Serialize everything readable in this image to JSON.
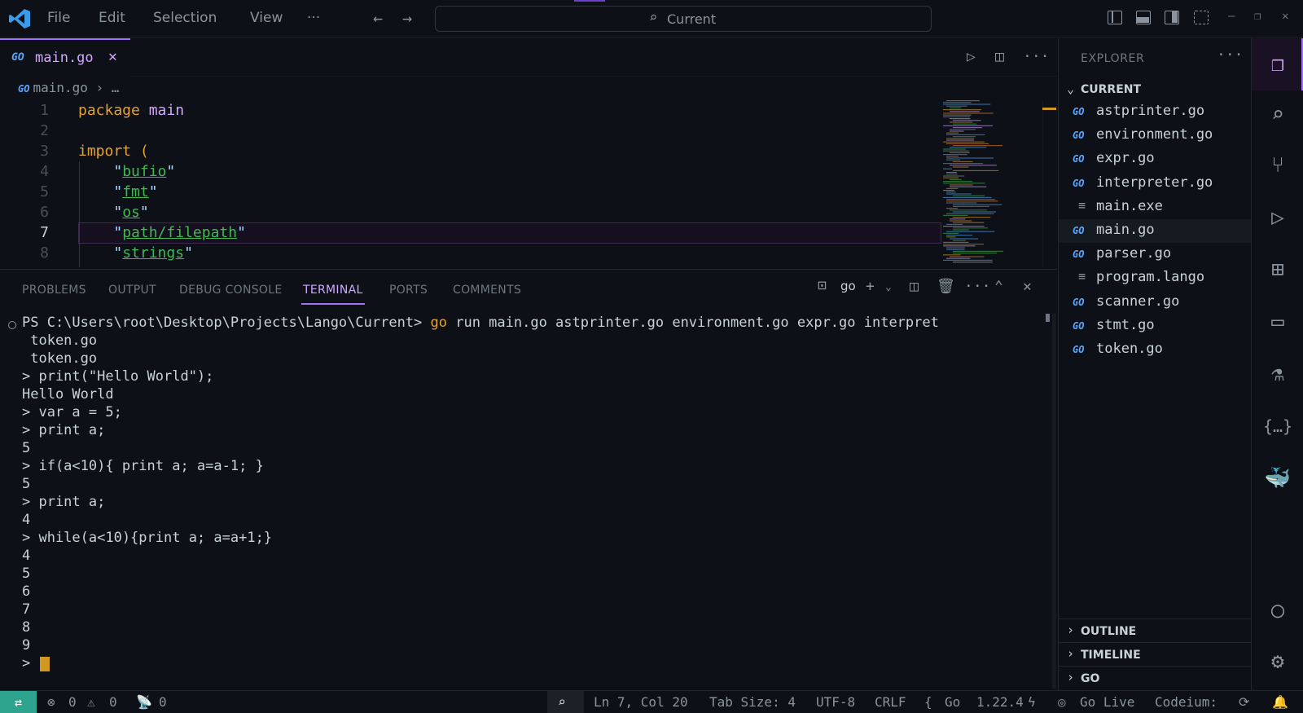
{
  "titlebar": {
    "menus": [
      "File",
      "Edit",
      "Selection",
      "View",
      "···"
    ],
    "command_center": "Current",
    "icons": [
      "vscode-logo",
      "arrow-left-icon",
      "arrow-right-icon",
      "search-icon",
      "toggle-sidebar-icon",
      "toggle-panel-icon",
      "toggle-secondary-icon",
      "customize-layout-icon"
    ],
    "window_controls": [
      "–",
      "❐",
      "✕"
    ]
  },
  "editor": {
    "tab_label": "main.go",
    "tab_file_icon": "GO",
    "breadcrumb_file": "main.go",
    "breadcrumb_rest": "…",
    "actions": [
      "run-icon",
      "split-editor-icon",
      "more-icon"
    ],
    "lines": [
      {
        "n": "1",
        "parts": [
          [
            "kw-orange",
            "package"
          ],
          [
            "",
            " "
          ],
          [
            "kw-purple",
            "main"
          ]
        ]
      },
      {
        "n": "2",
        "parts": []
      },
      {
        "n": "3",
        "parts": [
          [
            "kw-orange",
            "import"
          ],
          [
            "",
            " "
          ],
          [
            "kw-orange",
            "("
          ]
        ]
      },
      {
        "n": "4",
        "parts": [
          [
            "",
            "    "
          ],
          [
            "str",
            "\""
          ],
          [
            "str-inner",
            "bufio"
          ],
          [
            "str",
            "\""
          ]
        ]
      },
      {
        "n": "5",
        "parts": [
          [
            "",
            "    "
          ],
          [
            "str",
            "\""
          ],
          [
            "str-inner",
            "fmt"
          ],
          [
            "str",
            "\""
          ]
        ]
      },
      {
        "n": "6",
        "parts": [
          [
            "",
            "    "
          ],
          [
            "str",
            "\""
          ],
          [
            "str-inner",
            "os"
          ],
          [
            "str",
            "\""
          ]
        ]
      },
      {
        "n": "7",
        "parts": [
          [
            "",
            "    "
          ],
          [
            "str",
            "\""
          ],
          [
            "str-inner",
            "path/filepath"
          ],
          [
            "str",
            "\""
          ]
        ]
      },
      {
        "n": "8",
        "parts": [
          [
            "",
            "    "
          ],
          [
            "str",
            "\""
          ],
          [
            "str-inner",
            "strings"
          ],
          [
            "str",
            "\""
          ]
        ]
      }
    ]
  },
  "panel": {
    "tabs": [
      "PROBLEMS",
      "OUTPUT",
      "DEBUG CONSOLE",
      "TERMINAL",
      "PORTS",
      "COMMENTS"
    ],
    "active_tab": "TERMINAL",
    "terminal_kind": "go",
    "terminal": {
      "prompt_prefix": "PS C:\\Users\\root\\Desktop\\Projects\\Lango\\Current> ",
      "prompt_go": "go",
      "prompt_rest": " run main.go astprinter.go environment.go expr.go interpret",
      "lines": [
        " token.go",
        " token.go",
        "> print(\"Hello World\");",
        "Hello World",
        "> var a = 5;",
        "> print a;",
        "5",
        "> if(a<10){ print a; a=a-1; }",
        "5",
        "> print a;",
        "4",
        "> while(a<10){print a; a=a+1;}",
        "4",
        "5",
        "6",
        "7",
        "8",
        "9"
      ],
      "last_prompt": ">"
    }
  },
  "explorer": {
    "title": "EXPLORER",
    "folder": "CURRENT",
    "files": [
      {
        "name": "astprinter.go",
        "type": "go"
      },
      {
        "name": "environment.go",
        "type": "go"
      },
      {
        "name": "expr.go",
        "type": "go"
      },
      {
        "name": "interpreter.go",
        "type": "go"
      },
      {
        "name": "main.exe",
        "type": "doc"
      },
      {
        "name": "main.go",
        "type": "go",
        "selected": true
      },
      {
        "name": "parser.go",
        "type": "go"
      },
      {
        "name": "program.lango",
        "type": "doc"
      },
      {
        "name": "scanner.go",
        "type": "go"
      },
      {
        "name": "stmt.go",
        "type": "go"
      },
      {
        "name": "token.go",
        "type": "go"
      }
    ],
    "sections": [
      "OUTLINE",
      "TIMELINE",
      "GO"
    ]
  },
  "activity_icons": [
    "files-icon",
    "search-icon",
    "source-control-icon",
    "run-debug-icon",
    "extensions-icon",
    "remote-explorer-icon",
    "testing-icon",
    "json-icon",
    "docker-icon",
    "account-icon",
    "settings-gear-icon"
  ],
  "statusbar": {
    "errors": "0",
    "warnings": "0",
    "ports": "0",
    "position": "Ln 7, Col 20",
    "tab_size": "Tab Size: 4",
    "encoding": "UTF-8",
    "eol": "CRLF",
    "language": "Go",
    "go_version": "1.22.4",
    "go_live": "Go Live",
    "codeium": "Codeium:"
  },
  "colors": {
    "accent": "#a371f7",
    "keyword": "#e3a230",
    "package_name": "#d2a8ff",
    "string_inner": "#3fb950",
    "remote_badge": "#2ea48f",
    "go_icon": "#58a6ff"
  }
}
